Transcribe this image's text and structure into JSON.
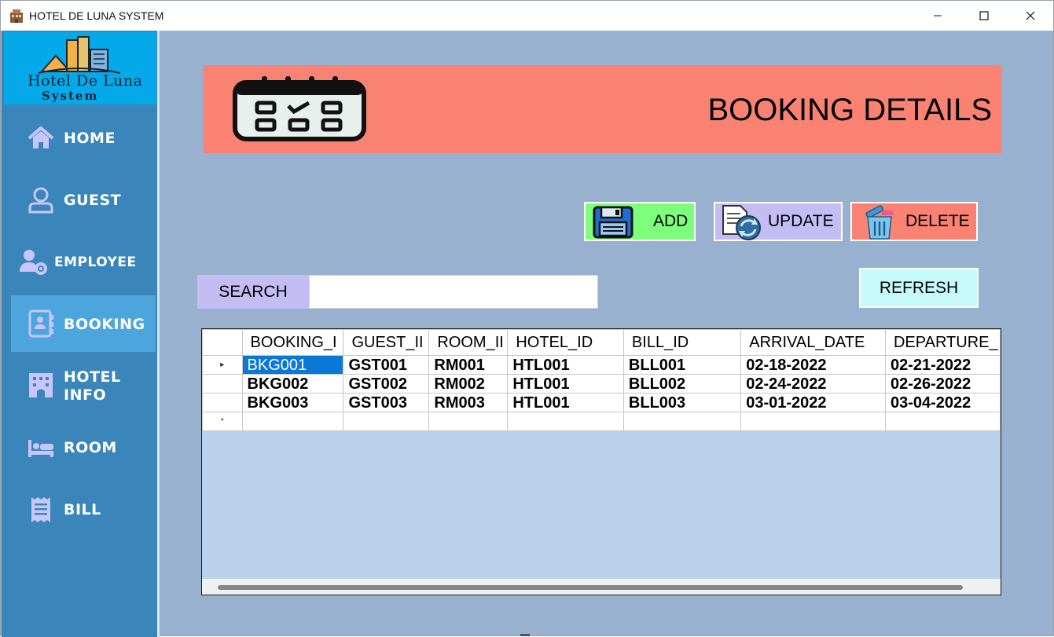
{
  "window": {
    "title": "HOTEL DE LUNA SYSTEM",
    "controls": {
      "minimize_icon": "minimize-icon",
      "maximize_icon": "maximize-icon",
      "close_icon": "close-icon"
    }
  },
  "sidebar": {
    "logo": {
      "line1": "Hotel De Luna",
      "line2": "System"
    },
    "items": [
      {
        "label": "HOME",
        "icon": "home-icon",
        "active": false
      },
      {
        "label": "GUEST",
        "icon": "user-icon",
        "active": false
      },
      {
        "label": "EMPLOYEE",
        "icon": "employee-gear-icon",
        "active": false
      },
      {
        "label": "BOOKING",
        "icon": "contact-book-icon",
        "active": true
      },
      {
        "label": "HOTEL",
        "label2": "INFO",
        "icon": "hotel-building-icon",
        "active": false
      },
      {
        "label": "ROOM",
        "icon": "bed-icon",
        "active": false
      },
      {
        "label": "BILL",
        "icon": "receipt-icon",
        "active": false
      }
    ]
  },
  "header": {
    "title": "BOOKING DETAILS",
    "icon": "calendar-icon"
  },
  "actions": {
    "add_label": "ADD",
    "update_label": "UPDATE",
    "delete_label": "DELETE",
    "refresh_label": "REFRESH"
  },
  "search": {
    "label": "SEARCH",
    "value": "",
    "placeholder": ""
  },
  "table": {
    "columns": [
      "BOOKING_I",
      "GUEST_II",
      "ROOM_II",
      "HOTEL_ID",
      "BILL_ID",
      "ARRIVAL_DATE",
      "DEPARTURE_"
    ],
    "rows": [
      [
        "BKG001",
        "GST001",
        "RM001",
        "HTL001",
        "BLL001",
        "02-18-2022",
        "02-21-2022"
      ],
      [
        "BKG002",
        "GST002",
        "RM002",
        "HTL001",
        "BLL002",
        "02-24-2022",
        "02-26-2022"
      ],
      [
        "BKG003",
        "GST003",
        "RM003",
        "HTL001",
        "BLL003",
        "03-01-2022",
        "03-04-2022"
      ]
    ],
    "current_row_marker": "▸",
    "new_row_marker": "*"
  },
  "colors": {
    "sidebar": "#3a86ba",
    "sidebar_active": "#4da5dd",
    "logo_bg": "#04a9ea",
    "content_bg": "#97b1cf",
    "banner": "#f98272",
    "add": "#7dff7b",
    "update": "#c3bdf4",
    "delete": "#f98272",
    "refresh": "#c7fbfb",
    "selected_cell": "#0a78d7",
    "grid_bg": "#b9d1ea"
  }
}
